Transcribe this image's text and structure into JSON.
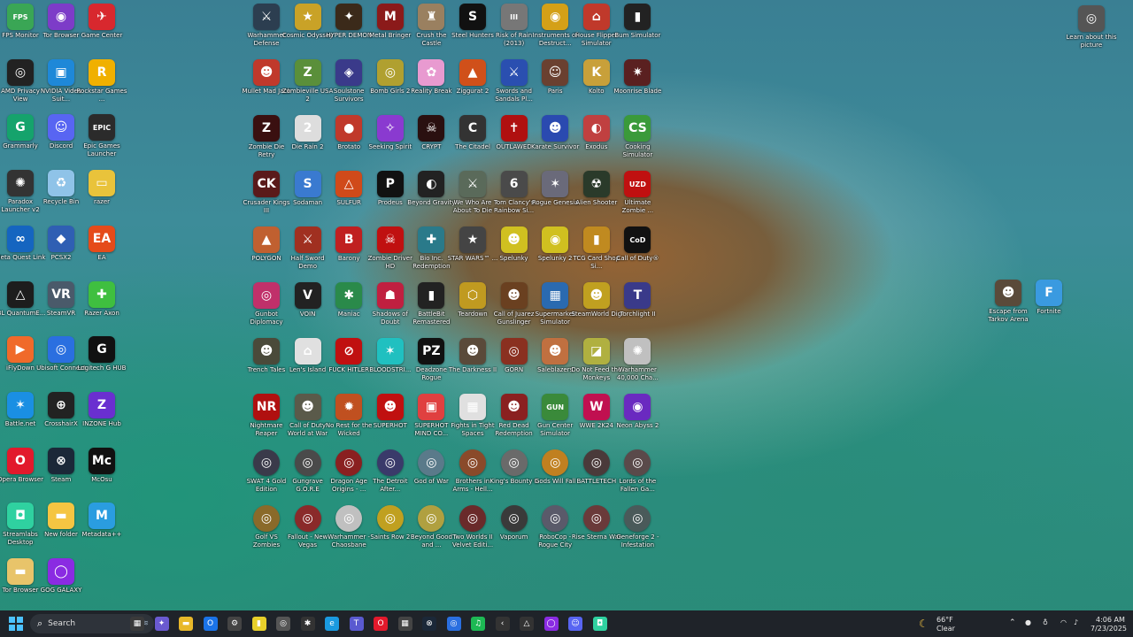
{
  "desktop": {
    "icons": [
      {
        "label": "FPS Monitor",
        "glyph": "FPS",
        "color": "#3aa655"
      },
      {
        "label": "Tor Browser",
        "glyph": "◉",
        "color": "#7d3cc8"
      },
      {
        "label": "Game Center",
        "glyph": "✈",
        "color": "#d8282e"
      },
      {
        "label": "AMD Privacy View",
        "glyph": "◎",
        "color": "#222222"
      },
      {
        "label": "NVIDIA Video Suit...",
        "glyph": "▣",
        "color": "#1e88d8"
      },
      {
        "label": "Rockstar Games ...",
        "glyph": "R",
        "color": "#f0b000"
      },
      {
        "label": "Grammarly",
        "glyph": "G",
        "color": "#15a36c"
      },
      {
        "label": "Discord",
        "glyph": "☺",
        "color": "#5865f2"
      },
      {
        "label": "Epic Games Launcher",
        "glyph": "EPIC",
        "color": "#2b2b2b"
      },
      {
        "label": "Paradox Launcher v2",
        "glyph": "✺",
        "color": "#333333"
      },
      {
        "label": "Recycle Bin",
        "glyph": "♻",
        "color": "#8fc3e8"
      },
      {
        "label": "razer",
        "glyph": "▭",
        "color": "#e9c33b"
      },
      {
        "label": "Meta Quest Link",
        "glyph": "∞",
        "color": "#1565c0"
      },
      {
        "label": "PCSX2",
        "glyph": "◆",
        "color": "#2f5fb3"
      },
      {
        "label": "EA",
        "glyph": "EA",
        "color": "#e54b1a"
      },
      {
        "label": "JBL QuantumE...",
        "glyph": "△",
        "color": "#1d1d1d"
      },
      {
        "label": "SteamVR",
        "glyph": "VR",
        "color": "#4a5a6a"
      },
      {
        "label": "Razer Axon",
        "glyph": "✚",
        "color": "#3fbf3f"
      },
      {
        "label": "iFlyDown",
        "glyph": "▶",
        "color": "#f06a2a"
      },
      {
        "label": "Ubisoft Connect",
        "glyph": "◎",
        "color": "#2a6fe0"
      },
      {
        "label": "Logitech G HUB",
        "glyph": "G",
        "color": "#111111"
      },
      {
        "label": "Battle.net",
        "glyph": "✶",
        "color": "#1a8fe3"
      },
      {
        "label": "CrosshairX",
        "glyph": "⊕",
        "color": "#222222"
      },
      {
        "label": "INZONE Hub",
        "glyph": "Z",
        "color": "#6a2fd0"
      },
      {
        "label": "Opera Browser",
        "glyph": "O",
        "color": "#e2192c"
      },
      {
        "label": "Steam",
        "glyph": "⊗",
        "color": "#1b2838"
      },
      {
        "label": "McOsu",
        "glyph": "Mc",
        "color": "#111111"
      },
      {
        "label": "Streamlabs Desktop",
        "glyph": "◘",
        "color": "#2fd1a0"
      },
      {
        "label": "New folder",
        "glyph": "▬",
        "color": "#f5c542"
      },
      {
        "label": "Metadata++",
        "glyph": "M",
        "color": "#2a9de0"
      },
      {
        "label": "Tor Browser",
        "glyph": "▬",
        "color": "#e8c46a"
      },
      {
        "label": "GOG GALAXY",
        "glyph": "◯",
        "color": "#8a2be2"
      },
      {
        "label": "Warhammer Defense",
        "glyph": "⚔",
        "color": "#2c3e50"
      },
      {
        "label": "Cosmic Odyssey",
        "glyph": "★",
        "color": "#c9a227"
      },
      {
        "label": "HYPER DEMON",
        "glyph": "✦",
        "color": "#3b2a1a"
      },
      {
        "label": "Metal Bringer",
        "glyph": "M",
        "color": "#8b1a1a"
      },
      {
        "label": "Crush the Castle",
        "glyph": "♜",
        "color": "#9a8060"
      },
      {
        "label": "Steel Hunters",
        "glyph": "S",
        "color": "#111111"
      },
      {
        "label": "Risk of Rain (2013)",
        "glyph": "III",
        "color": "#777777"
      },
      {
        "label": "Instruments of Destruct...",
        "glyph": "◉",
        "color": "#d4a017"
      },
      {
        "label": "House Flipper Simulator",
        "glyph": "⌂",
        "color": "#c0392b"
      },
      {
        "label": "Bum Simulator",
        "glyph": "▮",
        "color": "#222222"
      },
      {
        "label": "Mullet Mad Jack",
        "glyph": "☻",
        "color": "#c0392b"
      },
      {
        "label": "Zombieville USA 2",
        "glyph": "Z",
        "color": "#5a8f3a"
      },
      {
        "label": "Soulstone Survivors",
        "glyph": "◈",
        "color": "#3a3a8a"
      },
      {
        "label": "Bomb Girls 2",
        "glyph": "◎",
        "color": "#b0a030"
      },
      {
        "label": "Reality Break",
        "glyph": "✿",
        "color": "#e89ad0"
      },
      {
        "label": "Ziggurat 2",
        "glyph": "▲",
        "color": "#d0501a"
      },
      {
        "label": "Swords and Sandals Pl...",
        "glyph": "⚔",
        "color": "#2a4fb0"
      },
      {
        "label": "Paris",
        "glyph": "☺",
        "color": "#6a4030"
      },
      {
        "label": "Kolto",
        "glyph": "K",
        "color": "#c8a03a"
      },
      {
        "label": "Moonrise Blade",
        "glyph": "✷",
        "color": "#5a2020"
      },
      {
        "label": "Zombie Die Retry",
        "glyph": "Z",
        "color": "#3a1010"
      },
      {
        "label": "Die Rain 2",
        "glyph": "2",
        "color": "#dddddd"
      },
      {
        "label": "Brotato",
        "glyph": "●",
        "color": "#c0392b"
      },
      {
        "label": "Seeking Spirit",
        "glyph": "✧",
        "color": "#8a3ad0"
      },
      {
        "label": "CRYPT",
        "glyph": "☠",
        "color": "#2a1010"
      },
      {
        "label": "The Citadel",
        "glyph": "C",
        "color": "#333333"
      },
      {
        "label": "OUTLAWED",
        "glyph": "✝",
        "color": "#b01010"
      },
      {
        "label": "Karate Survivor",
        "glyph": "☻",
        "color": "#2a4ab0"
      },
      {
        "label": "Exodus",
        "glyph": "◐",
        "color": "#c04040"
      },
      {
        "label": "Cooking Simulator",
        "glyph": "CS",
        "color": "#3a9a3a"
      },
      {
        "label": "Crusader Kings III",
        "glyph": "CK",
        "color": "#5a1a1a"
      },
      {
        "label": "Sodaman",
        "glyph": "S",
        "color": "#3a7ad0"
      },
      {
        "label": "SULFUR",
        "glyph": "△",
        "color": "#d04a1a"
      },
      {
        "label": "Prodeus",
        "glyph": "P",
        "color": "#111111"
      },
      {
        "label": "Beyond Gravity",
        "glyph": "◐",
        "color": "#222222"
      },
      {
        "label": "We Who Are About To Die",
        "glyph": "⚔",
        "color": "#5a6a5a"
      },
      {
        "label": "Tom Clancy's Rainbow Si...",
        "glyph": "6",
        "color": "#4a4a4a"
      },
      {
        "label": "Rogue Genesia",
        "glyph": "✶",
        "color": "#6a6a7a"
      },
      {
        "label": "Alien Shooter",
        "glyph": "☢",
        "color": "#2a3a2a"
      },
      {
        "label": "Ultimate Zombie ...",
        "glyph": "UZD",
        "color": "#c01010"
      },
      {
        "label": "POLYGON",
        "glyph": "▲",
        "color": "#c06030"
      },
      {
        "label": "Half Sword Demo",
        "glyph": "⚔",
        "color": "#a03020"
      },
      {
        "label": "Barony",
        "glyph": "B",
        "color": "#c02020"
      },
      {
        "label": "Zombie Driver HD",
        "glyph": "☠",
        "color": "#c01010"
      },
      {
        "label": "Bio Inc. Redemption",
        "glyph": "✚",
        "color": "#2a7a8a"
      },
      {
        "label": "STAR WARS™ ...",
        "glyph": "★",
        "color": "#444444"
      },
      {
        "label": "Spelunky",
        "glyph": "☻",
        "color": "#d0c020"
      },
      {
        "label": "Spelunky 2",
        "glyph": "◉",
        "color": "#d0c020"
      },
      {
        "label": "TCG Card Shop Si...",
        "glyph": "▮",
        "color": "#c08a20"
      },
      {
        "label": "Call of Duty®",
        "glyph": "CoD",
        "color": "#111111"
      },
      {
        "label": "Gunbot Diplomacy",
        "glyph": "◎",
        "color": "#c0306a"
      },
      {
        "label": "VOIN",
        "glyph": "V",
        "color": "#222222"
      },
      {
        "label": "Maniac",
        "glyph": "✱",
        "color": "#2a8a4a"
      },
      {
        "label": "Shadows of Doubt",
        "glyph": "☗",
        "color": "#c02040"
      },
      {
        "label": "BattleBit Remastered",
        "glyph": "▮",
        "color": "#222222"
      },
      {
        "label": "Teardown",
        "glyph": "⬡",
        "color": "#c09a20"
      },
      {
        "label": "Call of Juarez Gunslinger",
        "glyph": "☻",
        "color": "#6a4020"
      },
      {
        "label": "Supermarket Simulator",
        "glyph": "▦",
        "color": "#2a6ab0"
      },
      {
        "label": "SteamWorld Dig",
        "glyph": "☻",
        "color": "#c0a020"
      },
      {
        "label": "Torchlight II",
        "glyph": "T",
        "color": "#3a3a8a"
      },
      {
        "label": "Trench Tales",
        "glyph": "☻",
        "color": "#4a4a3a"
      },
      {
        "label": "Len's Island",
        "glyph": "⌂",
        "color": "#e0e0e0"
      },
      {
        "label": "FUCK HITLER",
        "glyph": "⊘",
        "color": "#c01010"
      },
      {
        "label": "BLOODSTRI...",
        "glyph": "✶",
        "color": "#20c0c0"
      },
      {
        "label": "Deadzone Rogue",
        "glyph": "PZ",
        "color": "#111111"
      },
      {
        "label": "The Darkness II",
        "glyph": "☻",
        "color": "#5a4a3a"
      },
      {
        "label": "GORN",
        "glyph": "◎",
        "color": "#8a3020"
      },
      {
        "label": "Saleblazers",
        "glyph": "☻",
        "color": "#c07040"
      },
      {
        "label": "Do Not Feed the Monkeys",
        "glyph": "◪",
        "color": "#b0b040"
      },
      {
        "label": "Warhammer 40,000 Cha...",
        "glyph": "✺",
        "color": "#c0c0c0"
      },
      {
        "label": "Nightmare Reaper",
        "glyph": "NR",
        "color": "#b01010"
      },
      {
        "label": "Call of Duty World at War",
        "glyph": "☻",
        "color": "#5a5a4a"
      },
      {
        "label": "No Rest for the Wicked",
        "glyph": "✹",
        "color": "#c05020"
      },
      {
        "label": "SUPERHOT",
        "glyph": "☻",
        "color": "#c01010"
      },
      {
        "label": "SUPERHOT MIND CO...",
        "glyph": "▣",
        "color": "#e04040"
      },
      {
        "label": "Fights in Tight Spaces",
        "glyph": "▦",
        "color": "#e0e0e0"
      },
      {
        "label": "Red Dead Redemption",
        "glyph": "☻",
        "color": "#8a2020"
      },
      {
        "label": "Gun Center Simulator",
        "glyph": "GUN",
        "color": "#3a8a3a"
      },
      {
        "label": "WWE 2K24",
        "glyph": "W",
        "color": "#c01050"
      },
      {
        "label": "Neon Abyss 2",
        "glyph": "◉",
        "color": "#6a2ac0"
      },
      {
        "label": "SWAT 4 Gold Edition",
        "glyph": "◎",
        "color": "#3a3a4a"
      },
      {
        "label": "Gungrave G.O.R.E",
        "glyph": "◎",
        "color": "#4a4a4a"
      },
      {
        "label": "Dragon Age Origins - ...",
        "glyph": "◎",
        "color": "#8a2020"
      },
      {
        "label": "The Detroit After...",
        "glyph": "◎",
        "color": "#3a3a6a"
      },
      {
        "label": "God of War",
        "glyph": "◎",
        "color": "#5a7a8a"
      },
      {
        "label": "Brothers in Arms - Hell...",
        "glyph": "◎",
        "color": "#8a4a2a"
      },
      {
        "label": "King's Bounty II",
        "glyph": "◎",
        "color": "#6a6a6a"
      },
      {
        "label": "Gods Will Fall",
        "glyph": "◎",
        "color": "#c08020"
      },
      {
        "label": "BATTLETECH",
        "glyph": "◎",
        "color": "#4a3a3a"
      },
      {
        "label": "Lords of the Fallen Ga...",
        "glyph": "◎",
        "color": "#5a4a4a"
      },
      {
        "label": "Golf VS Zombies",
        "glyph": "◎",
        "color": "#8a6a2a"
      },
      {
        "label": "Fallout - New Vegas",
        "glyph": "◎",
        "color": "#8a2a2a"
      },
      {
        "label": "Warhammer - Chaosbane",
        "glyph": "◎",
        "color": "#c0c0c0"
      },
      {
        "label": "Saints Row 2",
        "glyph": "◎",
        "color": "#c0a020"
      },
      {
        "label": "Beyond Good and ...",
        "glyph": "◎",
        "color": "#b0a040"
      },
      {
        "label": "Two Worlds II Velvet Editi...",
        "glyph": "◎",
        "color": "#6a2a2a"
      },
      {
        "label": "Vaporum",
        "glyph": "◎",
        "color": "#3a3a3a"
      },
      {
        "label": "RoboCop - Rogue City",
        "glyph": "◎",
        "color": "#5a5a6a"
      },
      {
        "label": "Rise Sterna War",
        "glyph": "◎",
        "color": "#6a3a3a"
      },
      {
        "label": "Geneforge 2 - Infestation",
        "glyph": "◎",
        "color": "#4a5a5a"
      },
      {
        "label": "Escape from Tarkov Arena",
        "glyph": "☻",
        "color": "#5a4a3a"
      },
      {
        "label": "Fortnite",
        "glyph": "F",
        "color": "#3a9ae0"
      },
      {
        "label": "Learn about this picture",
        "glyph": "◎",
        "color": "#555555"
      }
    ]
  },
  "taskbar": {
    "search_placeholder": "Search",
    "weather_temp": "66°F",
    "weather_desc": "Clear",
    "time": "4:06 AM",
    "date": "7/23/2025",
    "pinned": [
      {
        "name": "taskview-icon",
        "glyph": "▦",
        "color": "#3a3a3a"
      },
      {
        "name": "copilot-icon",
        "glyph": "✦",
        "color": "#6a5ad0"
      },
      {
        "name": "file-explorer-icon",
        "glyph": "▬",
        "color": "#e8b82a"
      },
      {
        "name": "outlook-icon",
        "glyph": "O",
        "color": "#1a73e8"
      },
      {
        "name": "settings-icon",
        "glyph": "⚙",
        "color": "#444444"
      },
      {
        "name": "sticky-notes-icon",
        "glyph": "▮",
        "color": "#e8d02a"
      },
      {
        "name": "app-icon",
        "glyph": "◎",
        "color": "#555555"
      },
      {
        "name": "app-icon",
        "glyph": "✱",
        "color": "#333333"
      },
      {
        "name": "edge-icon",
        "glyph": "e",
        "color": "#1a9ae0"
      },
      {
        "name": "teams-icon",
        "glyph": "T",
        "color": "#5a5ad0"
      },
      {
        "name": "opera-icon",
        "glyph": "O",
        "color": "#e2192c"
      },
      {
        "name": "app-icon",
        "glyph": "▦",
        "color": "#444444"
      },
      {
        "name": "steam-icon",
        "glyph": "⊗",
        "color": "#1b2838"
      },
      {
        "name": "ubisoft-icon",
        "glyph": "◎",
        "color": "#2a6fe0"
      },
      {
        "name": "spotify-icon",
        "glyph": "♫",
        "color": "#1db954"
      },
      {
        "name": "app-icon",
        "glyph": "‹",
        "color": "#333333"
      },
      {
        "name": "app-icon",
        "glyph": "△",
        "color": "#333333"
      },
      {
        "name": "gog-icon",
        "glyph": "◯",
        "color": "#8a2be2"
      },
      {
        "name": "discord-icon",
        "glyph": "☺",
        "color": "#5865f2"
      },
      {
        "name": "streamlabs-icon",
        "glyph": "◘",
        "color": "#2fd1a0"
      }
    ]
  }
}
